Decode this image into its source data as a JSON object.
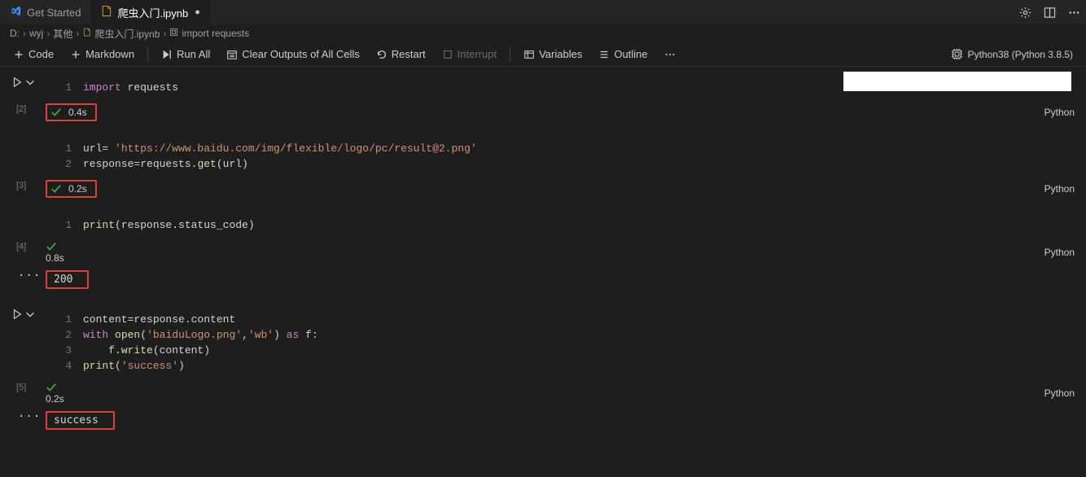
{
  "tabs": {
    "get_started": "Get Started",
    "notebook": "爬虫入门.ipynb"
  },
  "breadcrumbs": {
    "p0": "D:",
    "p1": "wyj",
    "p2": "其他",
    "p3": "爬虫入门.ipynb",
    "p4": "import requests"
  },
  "toolbar": {
    "code": "Code",
    "markdown": "Markdown",
    "runall": "Run All",
    "clear": "Clear Outputs of All Cells",
    "restart": "Restart",
    "interrupt": "Interrupt",
    "variables": "Variables",
    "outline": "Outline"
  },
  "kernel": "Python38 (Python 3.8.5)",
  "cells": [
    {
      "exec": "[2]",
      "status_time": "0.4s",
      "lang": "Python",
      "lines": [
        {
          "n": "1",
          "html": "<span class='k-import'>import</span> requests"
        }
      ],
      "highlight_status": true
    },
    {
      "exec": "[3]",
      "status_time": "0.2s",
      "lang": "Python",
      "lines": [
        {
          "n": "1",
          "html": "url= <span class='k-str'>'https://www.baidu.com/img/flexible/logo/pc/result@2.png'</span>"
        },
        {
          "n": "2",
          "html": "response=requests.<span class='k-func'>get</span>(url)"
        }
      ],
      "highlight_status": true
    },
    {
      "exec": "[4]",
      "status_time": "0.8s",
      "lang": "Python",
      "lines": [
        {
          "n": "1",
          "html": "<span class='k-func'>print</span>(response.status_code)"
        }
      ],
      "output": "200",
      "highlight_output": true
    },
    {
      "exec": "[5]",
      "status_time": "0.2s",
      "lang": "Python",
      "lines": [
        {
          "n": "1",
          "html": "content=response.content"
        },
        {
          "n": "2",
          "html": "<span class='k-with'>with</span> <span class='k-func'>open</span>(<span class='k-str'>'baiduLogo.png'</span>,<span class='k-str'>'wb'</span>) <span class='k-as'>as</span> f:"
        },
        {
          "n": "3",
          "html": "    f.<span class='k-func'>write</span>(content)"
        },
        {
          "n": "4",
          "html": "<span class='k-func'>print</span>(<span class='k-str'>'success'</span>)"
        }
      ],
      "output": "success",
      "highlight_output": true,
      "show_run": true
    }
  ]
}
